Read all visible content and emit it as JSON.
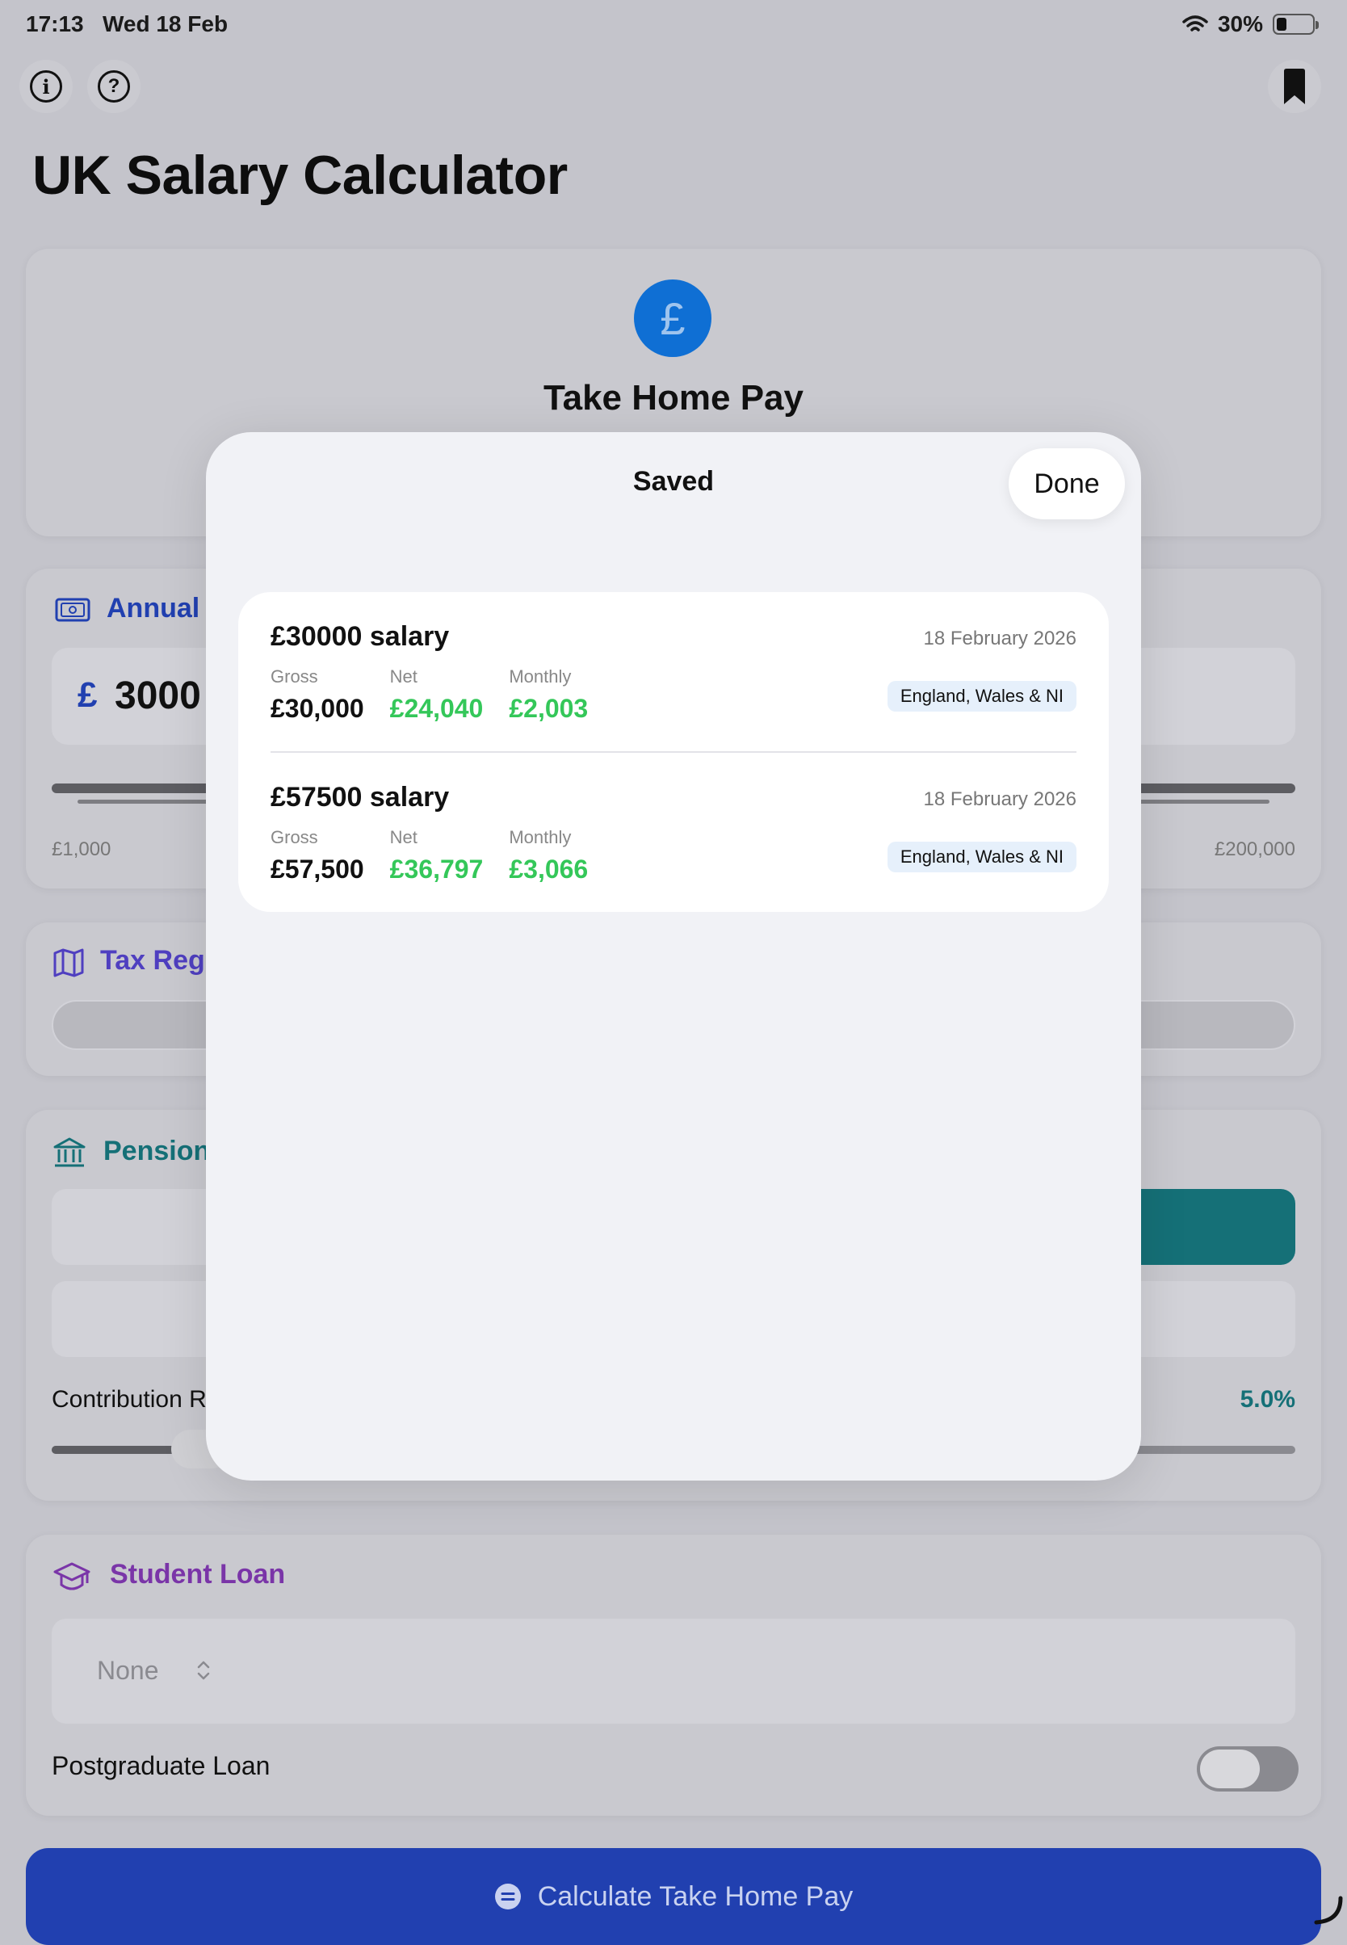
{
  "status_bar": {
    "time": "17:13",
    "date": "Wed 18 Feb",
    "battery": "30%",
    "battery_level": 0.3
  },
  "toolbar": {
    "info_icon": "info-icon",
    "help_icon": "help-icon",
    "bookmark_icon": "bookmark-icon"
  },
  "app": {
    "title": "UK Salary Calculator"
  },
  "hero": {
    "icon": "£",
    "title": "Take Home Pay"
  },
  "annual": {
    "label": "Annual",
    "currency": "£",
    "value": "3000",
    "min": "£1,000",
    "max": "£200,000"
  },
  "tax_region": {
    "label": "Tax Regi"
  },
  "pension": {
    "label": "Pension",
    "contribution_label": "Contribution R",
    "contribution_value": "5.0%"
  },
  "student_loan": {
    "label": "Student Loan",
    "selected": "None",
    "postgrad_label": "Postgraduate Loan"
  },
  "calculate": {
    "label": "Calculate Take Home Pay"
  },
  "sheet": {
    "title": "Saved",
    "done_label": "Done",
    "items": [
      {
        "title": "£30000 salary",
        "date": "18 February 2026",
        "gross_label": "Gross",
        "gross": "£30,000",
        "net_label": "Net",
        "net": "£24,040",
        "monthly_label": "Monthly",
        "monthly": "£2,003",
        "region": "England, Wales & NI"
      },
      {
        "title": "£57500 salary",
        "date": "18 February 2026",
        "gross_label": "Gross",
        "gross": "£57,500",
        "net_label": "Net",
        "net": "£36,797",
        "monthly_label": "Monthly",
        "monthly": "£3,066",
        "region": "England, Wales & NI"
      }
    ]
  },
  "colors": {
    "accent_blue": "#2140b0",
    "green": "#34c759",
    "teal": "#157077",
    "purple": "#7a35a8",
    "hero_blue": "#0f6fd4"
  }
}
